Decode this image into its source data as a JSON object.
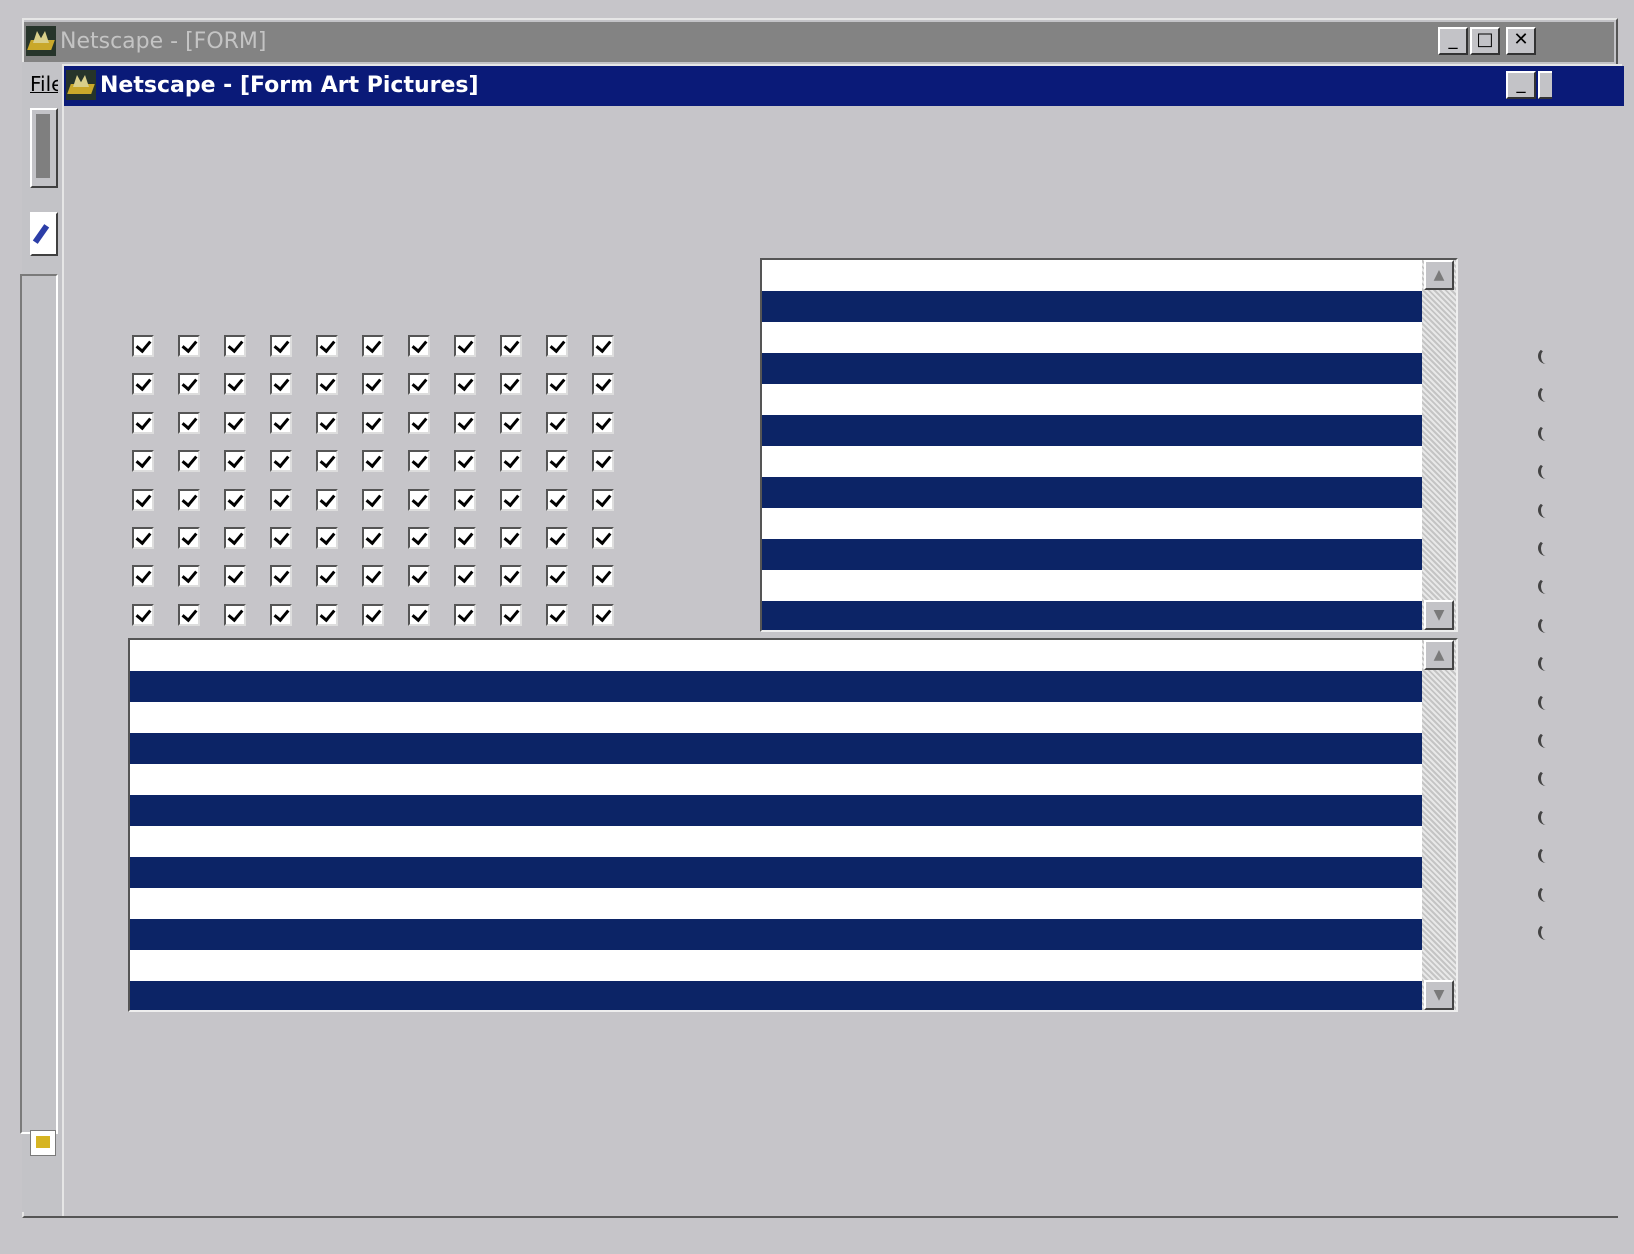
{
  "outer_window": {
    "title": "Netscape - [FORM]",
    "menu_file": "File",
    "minimize": "_",
    "maximize": "□",
    "close": "✕"
  },
  "inner_window": {
    "title": "Netscape - [Form Art Pictures]",
    "minimize": "_"
  },
  "checkbox_grid": {
    "rows": 8,
    "columns": 11,
    "all_checked": true
  },
  "list_boxes": [
    {
      "name": "upper-striped-listbox",
      "stripe_colors": [
        "#ffffff",
        "#0c2466"
      ]
    },
    {
      "name": "lower-striped-listbox",
      "stripe_colors": [
        "#ffffff",
        "#0c2466"
      ]
    }
  ],
  "scroll": {
    "up_arrow": "▲",
    "down_arrow": "▼"
  },
  "right_edge_radio_count": 16,
  "icons": {
    "app": "netscape-icon",
    "toolbar": "pencil-icon",
    "status": "status-icon"
  }
}
